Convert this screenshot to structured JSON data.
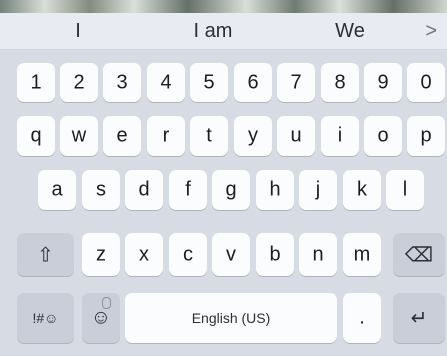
{
  "suggestions": [
    "I",
    "I am",
    "We"
  ],
  "suggestion_chevron": ">",
  "rows": {
    "numbers": [
      "1",
      "2",
      "3",
      "4",
      "5",
      "6",
      "7",
      "8",
      "9",
      "0"
    ],
    "top": [
      "q",
      "w",
      "e",
      "r",
      "t",
      "y",
      "u",
      "i",
      "o",
      "p"
    ],
    "middle": [
      "a",
      "s",
      "d",
      "f",
      "g",
      "h",
      "j",
      "k",
      "l"
    ],
    "bottom": [
      "z",
      "x",
      "c",
      "v",
      "b",
      "n",
      "m"
    ]
  },
  "special_keys": {
    "shift_icon": "⇧",
    "backspace_icon": "⌫",
    "symbols": "!#☺",
    "emoji": "☺",
    "space": "English (US)",
    "period": ".",
    "enter_icon": "↵"
  }
}
